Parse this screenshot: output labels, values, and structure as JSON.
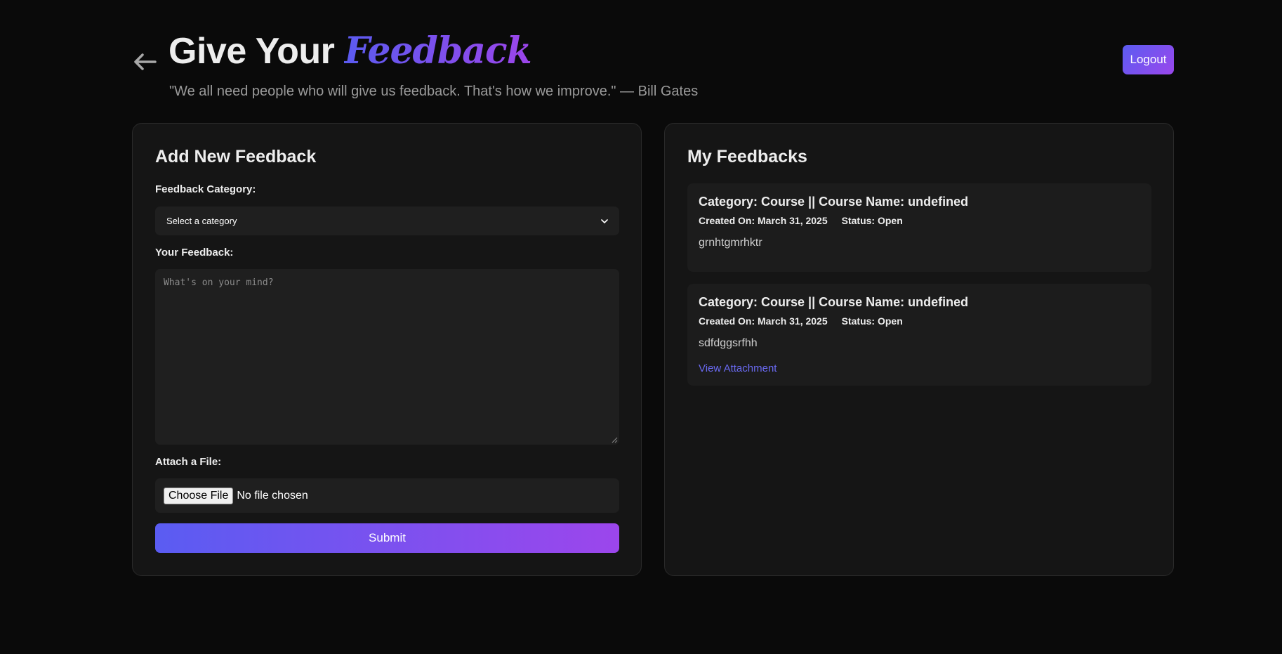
{
  "header": {
    "title_main": "Give Your",
    "title_accent": "Feedback",
    "quote": "\"We all need people who will give us feedback. That's how we improve.\" — Bill Gates",
    "logout_label": "Logout"
  },
  "add_feedback": {
    "heading": "Add New Feedback",
    "category_label": "Feedback Category:",
    "category_selected": "Select a category",
    "feedback_label": "Your Feedback:",
    "feedback_placeholder": "What's on your mind?",
    "attach_label": "Attach a File:",
    "choose_file_label": "Choose File",
    "file_status": "No file chosen",
    "submit_label": "Submit"
  },
  "my_feedbacks": {
    "heading": "My Feedbacks",
    "items": [
      {
        "title": "Category: Course || Course Name: undefined",
        "created": "Created On: March 31, 2025",
        "status": "Status: Open",
        "text": "grnhtgmrhktr",
        "attachment_label": ""
      },
      {
        "title": "Category: Course || Course Name: undefined",
        "created": "Created On: March 31, 2025",
        "status": "Status: Open",
        "text": "sdfdggsrfhh",
        "attachment_label": "View Attachment"
      }
    ]
  },
  "colors": {
    "background": "#0a0a0a",
    "panel": "#151515",
    "accent_start": "#5b5bf0",
    "accent_end": "#9c45ea",
    "link": "#6a6af2"
  },
  "icons": {
    "back": "arrow-left-icon",
    "select": "chevron-down-icon"
  }
}
